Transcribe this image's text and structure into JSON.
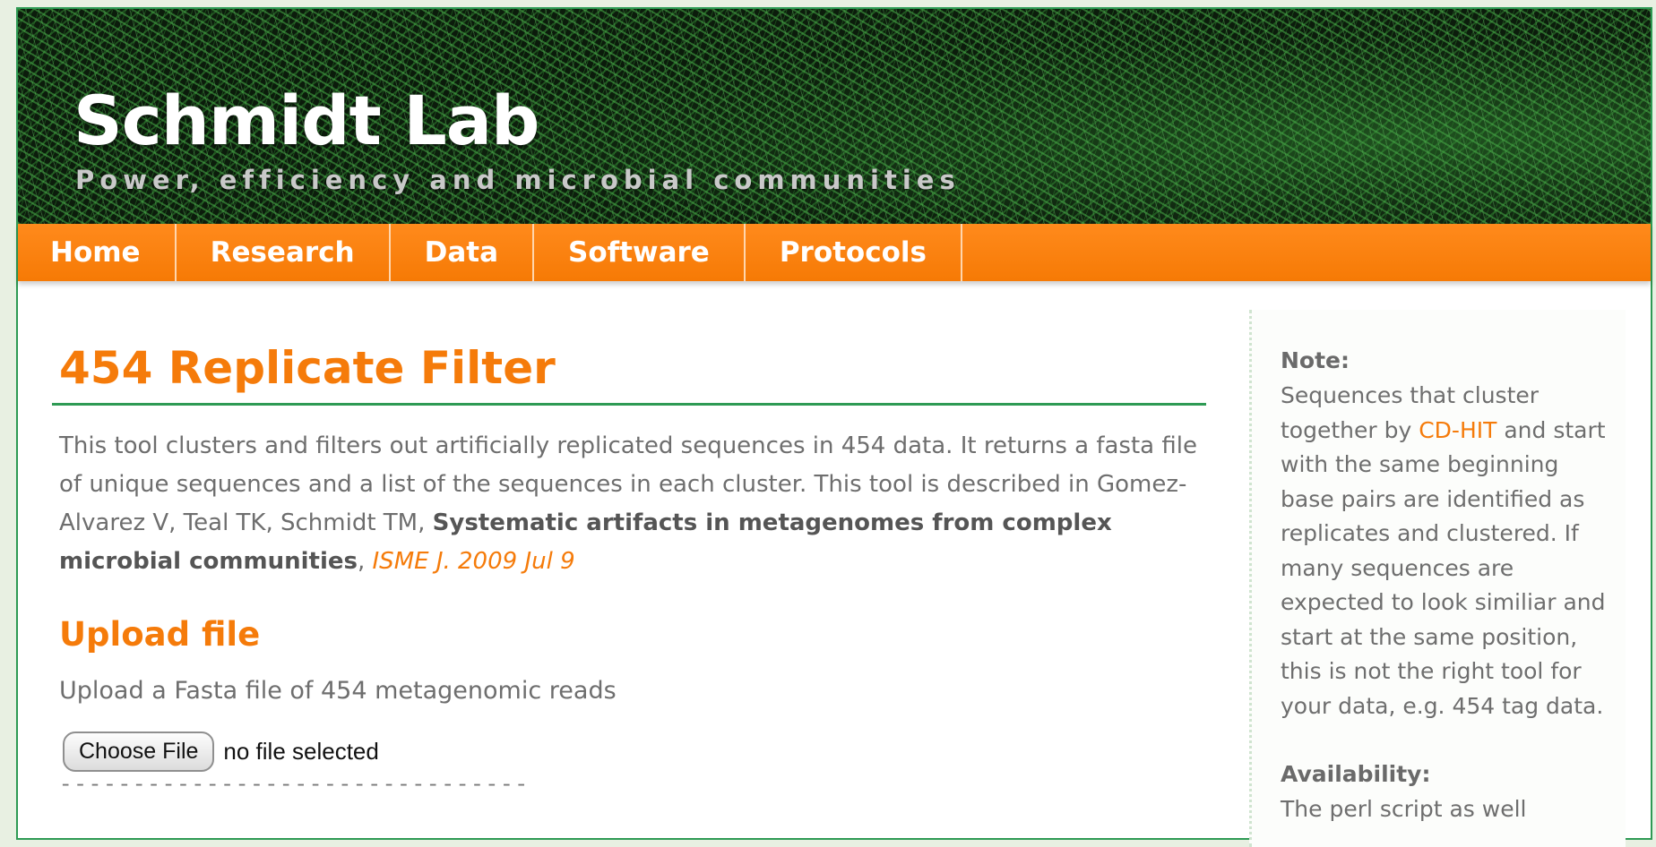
{
  "header": {
    "title": "Schmidt Lab",
    "tagline": "Power, efficiency and microbial communities"
  },
  "nav": {
    "items": [
      {
        "label": "Home"
      },
      {
        "label": "Research"
      },
      {
        "label": "Data"
      },
      {
        "label": "Software"
      },
      {
        "label": "Protocols"
      }
    ]
  },
  "main": {
    "title": "454 Replicate Filter",
    "intro": {
      "text_before": "This tool clusters and filters out artificially replicated sequences in 454 data. It returns a fasta file of unique sequences and a list of the sequences in each cluster. This tool is described in Gomez-Alvarez V, Teal TK, Schmidt TM, ",
      "paper_title": "Systematic artifacts in metagenomes from complex microbial communities",
      "separator": ", ",
      "citation_link": "ISME J. 2009 Jul 9"
    },
    "upload": {
      "heading": "Upload file",
      "description": "Upload a Fasta file of 454 metagenomic reads",
      "button_label": "Choose File",
      "status": "no file selected",
      "divider": "--------------------------------"
    }
  },
  "sidebar": {
    "note_label": "Note:",
    "note_text_before": "Sequences that cluster together by ",
    "note_link": "CD-HIT",
    "note_text_after": " and start with the same beginning base pairs are identified as replicates and clustered. If many sequences are expected to look similiar and start at the same position, this is not the right tool for your data, e.g. 454 tag data.",
    "availability_label": "Availability:",
    "availability_text": "The perl script as well"
  },
  "colors": {
    "accent": "#f57b0a",
    "nav_background": "#f67a05",
    "border_green": "#2e9a54",
    "body_text": "#6e6e6e"
  }
}
